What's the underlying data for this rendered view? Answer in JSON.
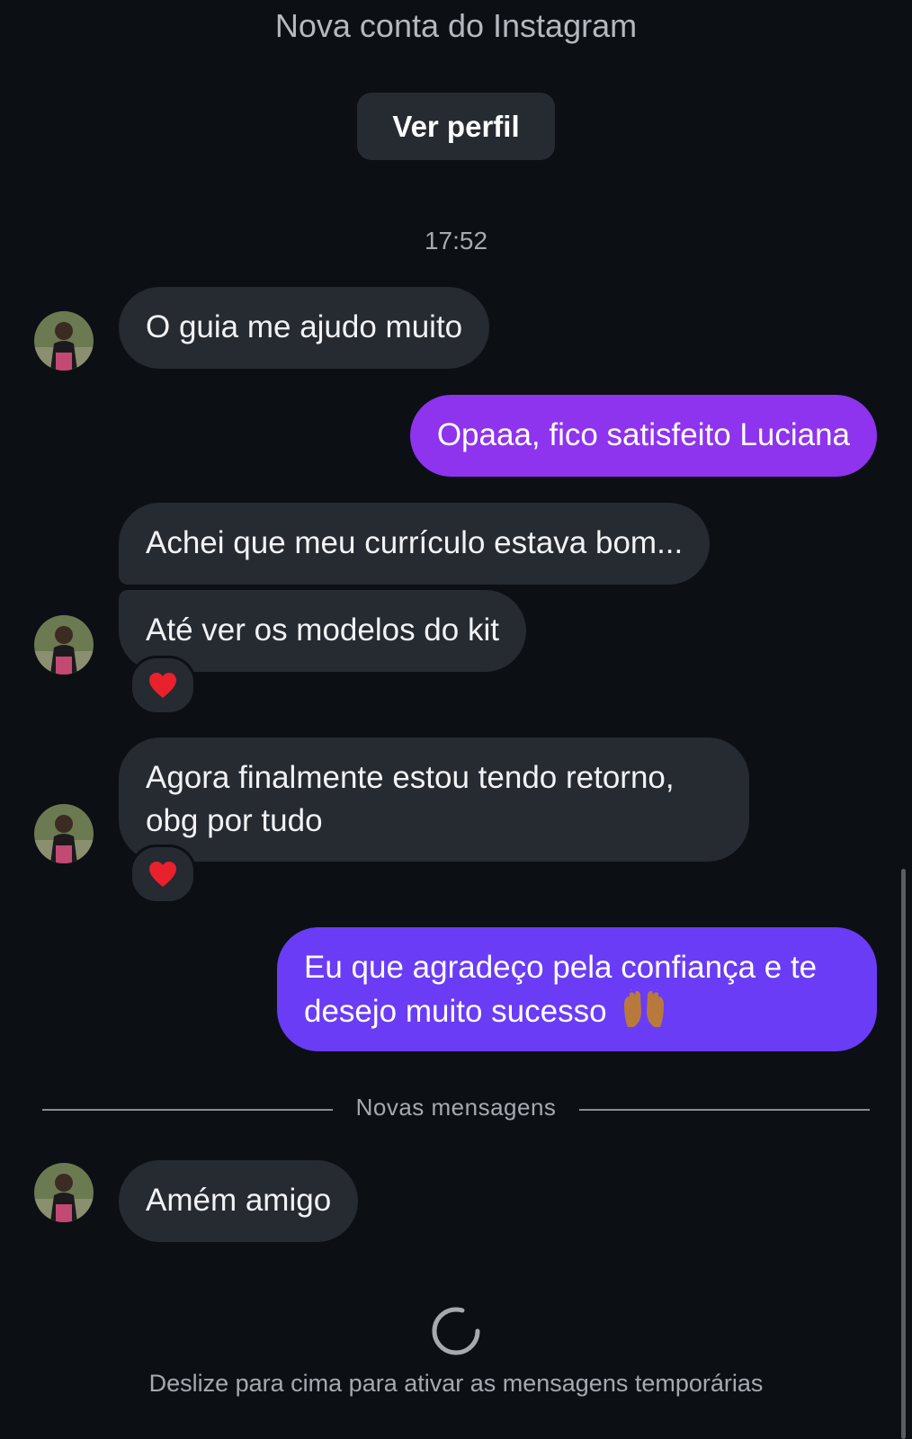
{
  "header": {
    "subtitle": "Nova conta do Instagram",
    "view_profile_label": "Ver perfil"
  },
  "thread": {
    "timestamp": "17:52",
    "messages": [
      {
        "from": "contact",
        "text": "O guia me ajudo muito"
      },
      {
        "from": "me",
        "text": "Opaaa, fico satisfeito Luciana"
      },
      {
        "from": "contact",
        "text": "Achei que meu currículo estava bom..."
      },
      {
        "from": "contact",
        "text": "Até ver os modelos do kit",
        "reaction": "heart"
      },
      {
        "from": "contact",
        "text_line1": "Agora finalmente estou tendo retorno,",
        "text_line2": "obg por tudo",
        "reaction": "heart"
      },
      {
        "from": "me",
        "text_line1": "Eu que agradeço pela confiança e te",
        "text_line2": "desejo muito sucesso",
        "emoji": "raising-hands"
      },
      {
        "from": "contact",
        "text": "Amém amigo"
      }
    ],
    "new_messages_label": "Novas mensagens"
  },
  "footer": {
    "hint": "Deslize para cima para ativar as mensagens temporárias"
  },
  "colors": {
    "background": "#0c0f14",
    "incoming_bubble": "#262a31",
    "outgoing_bubble_1": "#8e33ee",
    "outgoing_bubble_2": "#6a3cf5",
    "reaction_heart": "#e8212c"
  }
}
